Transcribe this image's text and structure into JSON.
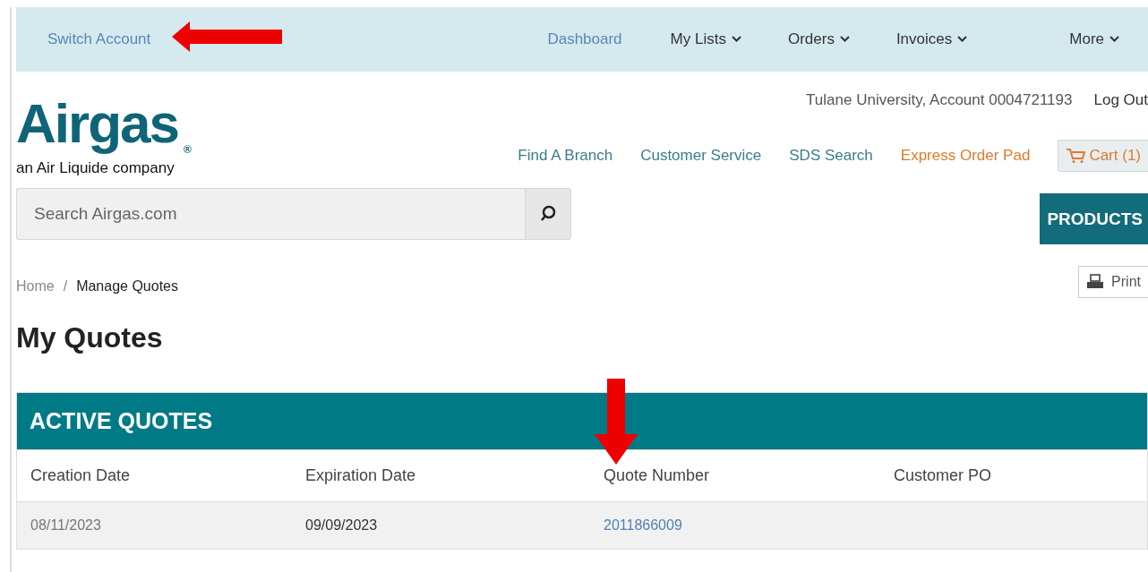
{
  "top_nav": {
    "switch_account": "Switch Account",
    "items": [
      {
        "label": "Dashboard",
        "kind": "link"
      },
      {
        "label": "My Lists",
        "kind": "dropdown"
      },
      {
        "label": "Orders",
        "kind": "dropdown"
      },
      {
        "label": "Invoices",
        "kind": "dropdown"
      },
      {
        "label": "More",
        "kind": "dropdown"
      }
    ]
  },
  "header": {
    "logo": "Airgas",
    "logo_registered": "®",
    "tagline": "an Air Liquide company",
    "account": "Tulane University, Account 0004721193",
    "logout": "Log Out",
    "links": [
      {
        "label": "Find A Branch",
        "kind": "teal"
      },
      {
        "label": "Customer Service",
        "kind": "teal"
      },
      {
        "label": "SDS Search",
        "kind": "teal"
      },
      {
        "label": "Express Order Pad",
        "kind": "orange"
      }
    ],
    "cart": "Cart (1)"
  },
  "search": {
    "placeholder": "Search Airgas.com"
  },
  "products_button": "PRODUCTS",
  "breadcrumb": [
    {
      "label": "Home",
      "selected": false
    },
    {
      "label": "Manage Quotes",
      "selected": true
    }
  ],
  "breadcrumb_separator": "/",
  "print_button": "Print",
  "page_title": "My Quotes",
  "active_quotes": {
    "title": "ACTIVE QUOTES",
    "columns": [
      "Creation Date",
      "Expiration Date",
      "Quote Number",
      "Customer PO"
    ],
    "rows": [
      {
        "cells": [
          "08/11/2023",
          "09/09/2023",
          "2011866009",
          null
        ]
      }
    ]
  },
  "annotations": [
    {
      "kind": "left_arrow"
    },
    {
      "kind": "down_arrow"
    }
  ]
}
